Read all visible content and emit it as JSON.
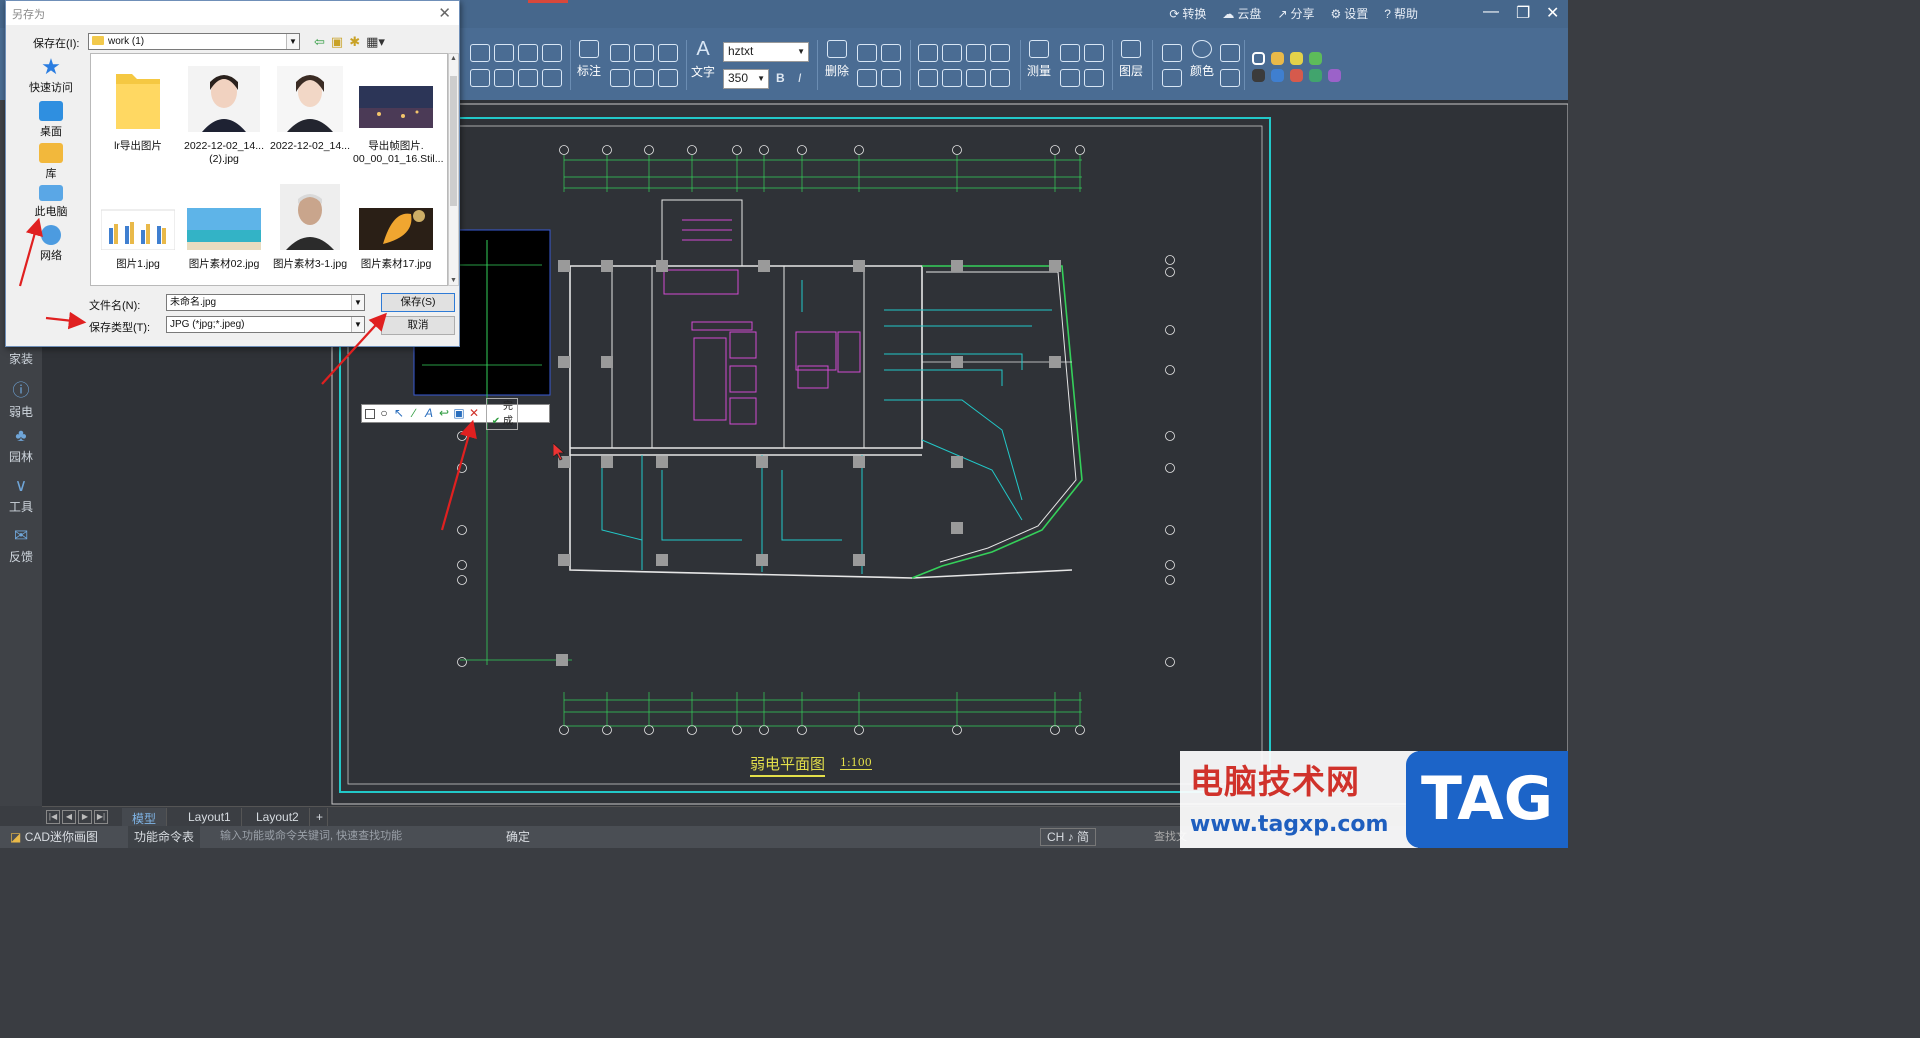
{
  "app": {
    "top_links": [
      {
        "icon": "convert-icon",
        "label": "转换"
      },
      {
        "icon": "cloud-icon",
        "label": "云盘"
      },
      {
        "icon": "share-icon",
        "label": "分享"
      },
      {
        "icon": "gear-icon",
        "label": "设置"
      },
      {
        "icon": "help-icon",
        "label": "帮助"
      }
    ],
    "toolbar": {
      "annotate_label": "标注",
      "text_label": "文字",
      "font_name": "hztxt",
      "font_size": "350",
      "bold": "B",
      "italic": "I",
      "delete_label": "删除",
      "measure_label": "测量",
      "layer_label": "图层",
      "color_label": "颜色"
    },
    "swatches": [
      "#ffffff",
      "#e9b949",
      "#e4d24a",
      "#5dbb5a",
      "#3b3b3b",
      "#3f7fd0",
      "#d65a4c",
      "#41a46d",
      "#9b62c9"
    ]
  },
  "side_panel": [
    {
      "label": "家装",
      "icon": "home-icon"
    },
    {
      "label": "弱电",
      "icon": "lightning-icon"
    },
    {
      "label": "园林",
      "icon": "tree-icon"
    },
    {
      "label": "工具",
      "icon": "tools-icon"
    },
    {
      "label": "反馈",
      "icon": "mail-icon"
    }
  ],
  "drawing": {
    "title": "弱电平面图",
    "scale": "1:100",
    "colors": {
      "wall": "#e6e6e6",
      "grid": "#35d05a",
      "frame": "#22c8c8",
      "magenta": "#d24bd2",
      "yellow": "#e3df4a"
    }
  },
  "snip_toolbar": {
    "tools": [
      "rectangle-icon",
      "circle-icon",
      "arrow-icon",
      "pen-icon",
      "text-icon",
      "undo-icon",
      "save-icon",
      "close-icon"
    ],
    "done_label": "完成"
  },
  "tabs": {
    "model": "模型",
    "layout1": "Layout1",
    "layout2": "Layout2",
    "add": "+"
  },
  "status": {
    "app_name": "CAD迷你画图",
    "cmd_table": "功能命令表",
    "cmd_placeholder": "输入功能或命令关键词, 快速查找功能",
    "confirm": "确定",
    "ime": "CH ♪ 简",
    "search": "查找文"
  },
  "dialog": {
    "title": "另存为",
    "save_in_label": "保存在(I):",
    "save_in_value": "work (1)",
    "places": [
      {
        "label": "快速访问",
        "icon": "star-icon"
      },
      {
        "label": "桌面",
        "icon": "desktop-icon"
      },
      {
        "label": "库",
        "icon": "library-icon"
      },
      {
        "label": "此电脑",
        "icon": "computer-icon"
      },
      {
        "label": "网络",
        "icon": "network-icon"
      }
    ],
    "files": [
      {
        "name": "lr导出图片",
        "line2": "",
        "kind": "folder"
      },
      {
        "name": "2022-12-02_14...",
        "line2": "(2).jpg",
        "kind": "portrait"
      },
      {
        "name": "2022-12-02_14...",
        "line2": "",
        "kind": "portrait2"
      },
      {
        "name": "导出帧图片.",
        "line2": "00_00_01_16.Stil...",
        "kind": "city"
      },
      {
        "name": "图片1.jpg",
        "line2": "",
        "kind": "chart"
      },
      {
        "name": "图片素材02.jpg",
        "line2": "",
        "kind": "beach"
      },
      {
        "name": "图片素材3-1.jpg",
        "line2": "",
        "kind": "elder"
      },
      {
        "name": "图片素材17.jpg",
        "line2": "",
        "kind": "leaf"
      }
    ],
    "filename_label": "文件名(N):",
    "filename_value": "未命名.jpg",
    "filetype_label": "保存类型(T):",
    "filetype_value": "JPG (*jpg;*.jpeg)",
    "save_button": "保存(S)",
    "cancel_button": "取消"
  },
  "watermark": {
    "title": "电脑技术网",
    "url": "www.tagxp.com",
    "tag": "TAG"
  }
}
